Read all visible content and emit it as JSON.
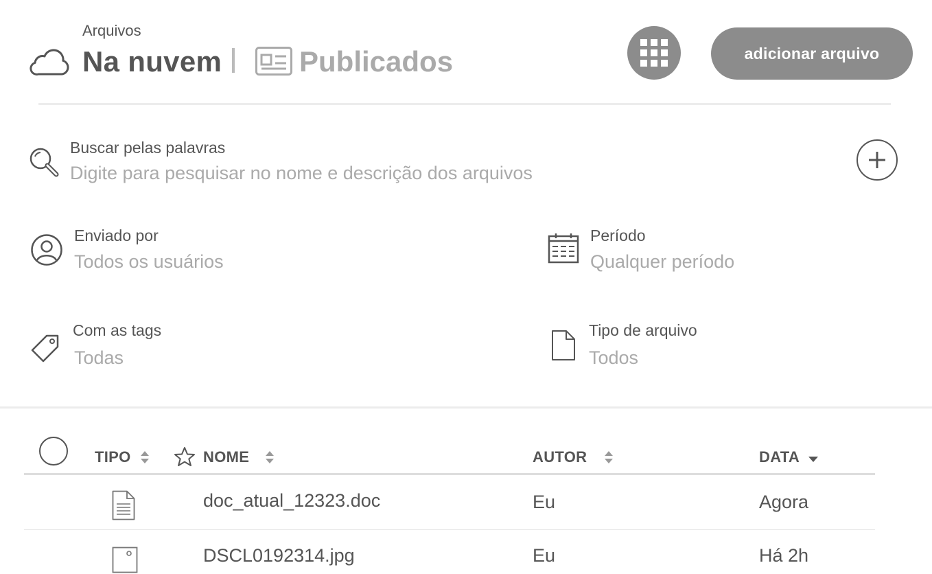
{
  "header": {
    "section_label": "Arquivos",
    "tab_cloud": "Na nuvem",
    "tab_published": "Publicados",
    "add_button": "adicionar arquivo"
  },
  "search": {
    "label": "Buscar pelas palavras",
    "placeholder": "Digite para pesquisar no nome e descrição dos arquivos",
    "value": ""
  },
  "filters": {
    "sent_by": {
      "label": "Enviado por",
      "value": "Todos os usuários"
    },
    "period": {
      "label": "Período",
      "value": "Qualquer período"
    },
    "tags": {
      "label": "Com as tags",
      "value": "Todas"
    },
    "file_type": {
      "label": "Tipo de arquivo",
      "value": "Todos"
    }
  },
  "table": {
    "columns": {
      "type": "TIPO",
      "name": "NOME",
      "author": "AUTOR",
      "date": "DATA"
    },
    "rows": [
      {
        "icon": "document-icon",
        "name": "doc_atual_12323.doc",
        "author": "Eu",
        "date": "Agora"
      },
      {
        "icon": "image-icon",
        "name": "DSCL0192314.jpg",
        "author": "Eu",
        "date": "Há 2h"
      }
    ]
  }
}
